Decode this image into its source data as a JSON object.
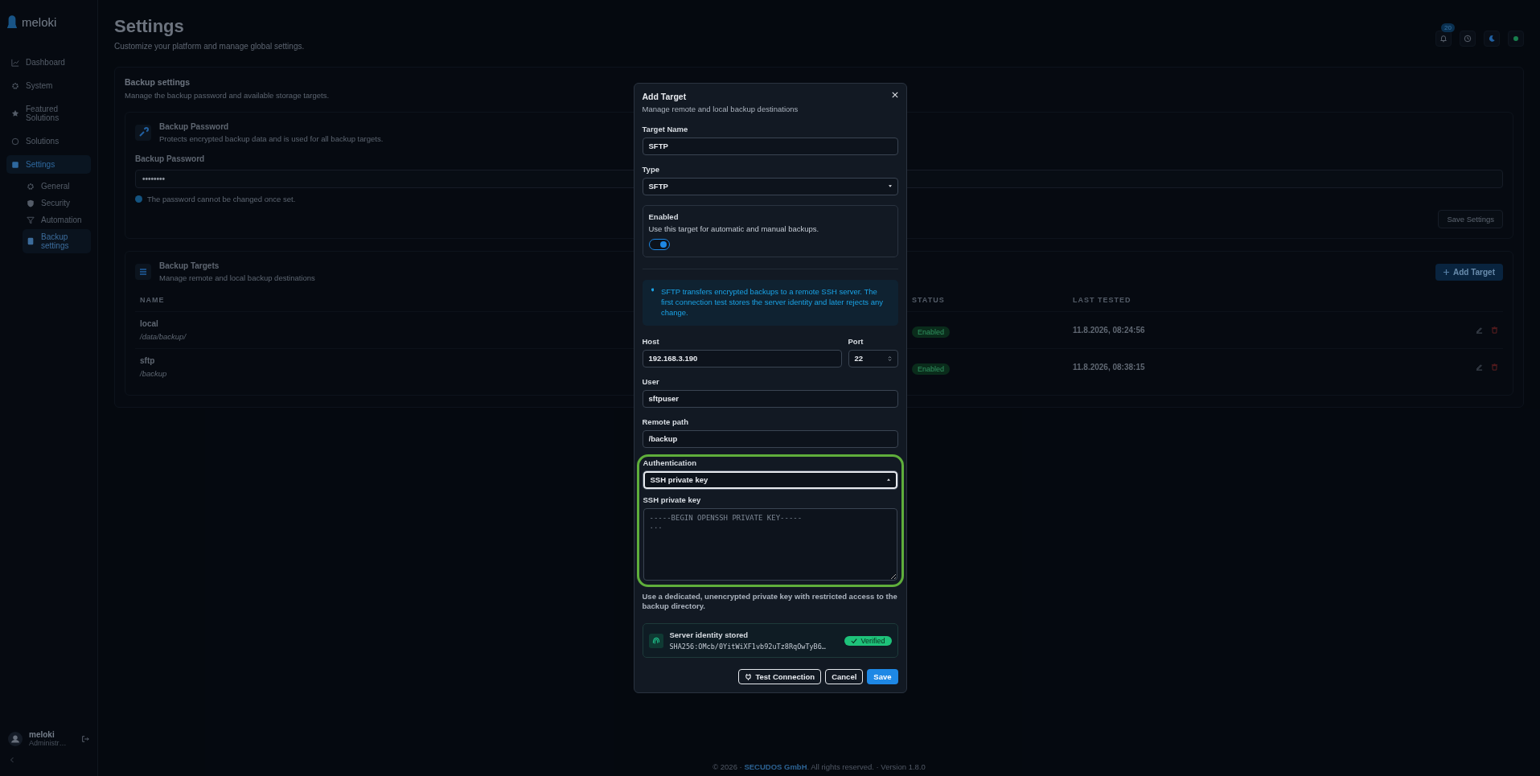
{
  "sidebar": {
    "logo": "meloki",
    "items": [
      {
        "label": "Dashboard",
        "selected": false
      },
      {
        "label": "System",
        "selected": false
      },
      {
        "label": "Featured Solutions",
        "selected": false
      },
      {
        "label": "Solutions",
        "selected": false
      },
      {
        "label": "Settings",
        "selected": true,
        "children": [
          {
            "label": "General",
            "selected": false
          },
          {
            "label": "Security",
            "selected": false
          },
          {
            "label": "Automation",
            "selected": false
          },
          {
            "label": "Backup settings",
            "selected": true
          }
        ]
      }
    ],
    "user": {
      "name": "meloki",
      "role": "Administr…"
    }
  },
  "header": {
    "title": "Settings",
    "subtitle": "Customize your platform and manage global settings.",
    "notification_count": "20"
  },
  "section": {
    "title": "Backup settings",
    "subtitle": "Manage the backup password and available storage targets."
  },
  "password_card": {
    "title": "Backup Password",
    "subtitle": "Protects encrypted backup data and is used for all backup targets.",
    "field_label": "Backup Password",
    "value": "••••••••",
    "note": "The password cannot be changed once set.",
    "save_button": "Save Settings"
  },
  "targets_card": {
    "title": "Backup Targets",
    "subtitle": "Manage remote and local backup destinations",
    "add_button": "Add Target",
    "columns": [
      "NAME",
      "STATUS",
      "LAST TESTED"
    ],
    "rows": [
      {
        "name": "local",
        "path": "/data/backup/",
        "status": "Enabled",
        "last_tested": "11.8.2026, 08:24:56"
      },
      {
        "name": "sftp",
        "path": "/backup",
        "status": "Enabled",
        "last_tested": "11.8.2026, 08:38:15"
      }
    ]
  },
  "footer": {
    "prefix": "© 2026 · ",
    "company": "SECUDOS GmbH",
    "suffix": ". All rights reserved. · Version 1.8.0"
  },
  "dialog": {
    "title": "Add Target",
    "subtitle": "Manage remote and local backup destinations",
    "target_name": {
      "label": "Target Name",
      "value": "SFTP"
    },
    "type": {
      "label": "Type",
      "value": "SFTP"
    },
    "enabled_card": {
      "title": "Enabled",
      "description": "Use this target for automatic and manual backups.",
      "on": true
    },
    "info": "SFTP transfers encrypted backups to a remote SSH server. The first connection test stores the server identity and later rejects any change.",
    "host": {
      "label": "Host",
      "value": "192.168.3.190"
    },
    "port": {
      "label": "Port",
      "value": "22"
    },
    "user": {
      "label": "User",
      "value": "sftpuser"
    },
    "remote_path": {
      "label": "Remote path",
      "value": "/backup"
    },
    "authentication": {
      "label": "Authentication",
      "value": "SSH private key"
    },
    "private_key": {
      "label": "SSH private key",
      "placeholder": "-----BEGIN OPENSSH PRIVATE KEY-----\n..."
    },
    "hint": "Use a dedicated, unencrypted private key with restricted access to the backup directory.",
    "identity": {
      "title": "Server identity stored",
      "fingerprint": "SHA256:OMcb/0YitWiXF1vb92uTz8RqOwTyB6…",
      "badge": "Verified"
    },
    "buttons": {
      "test": "Test Connection",
      "cancel": "Cancel",
      "save": "Save"
    }
  }
}
